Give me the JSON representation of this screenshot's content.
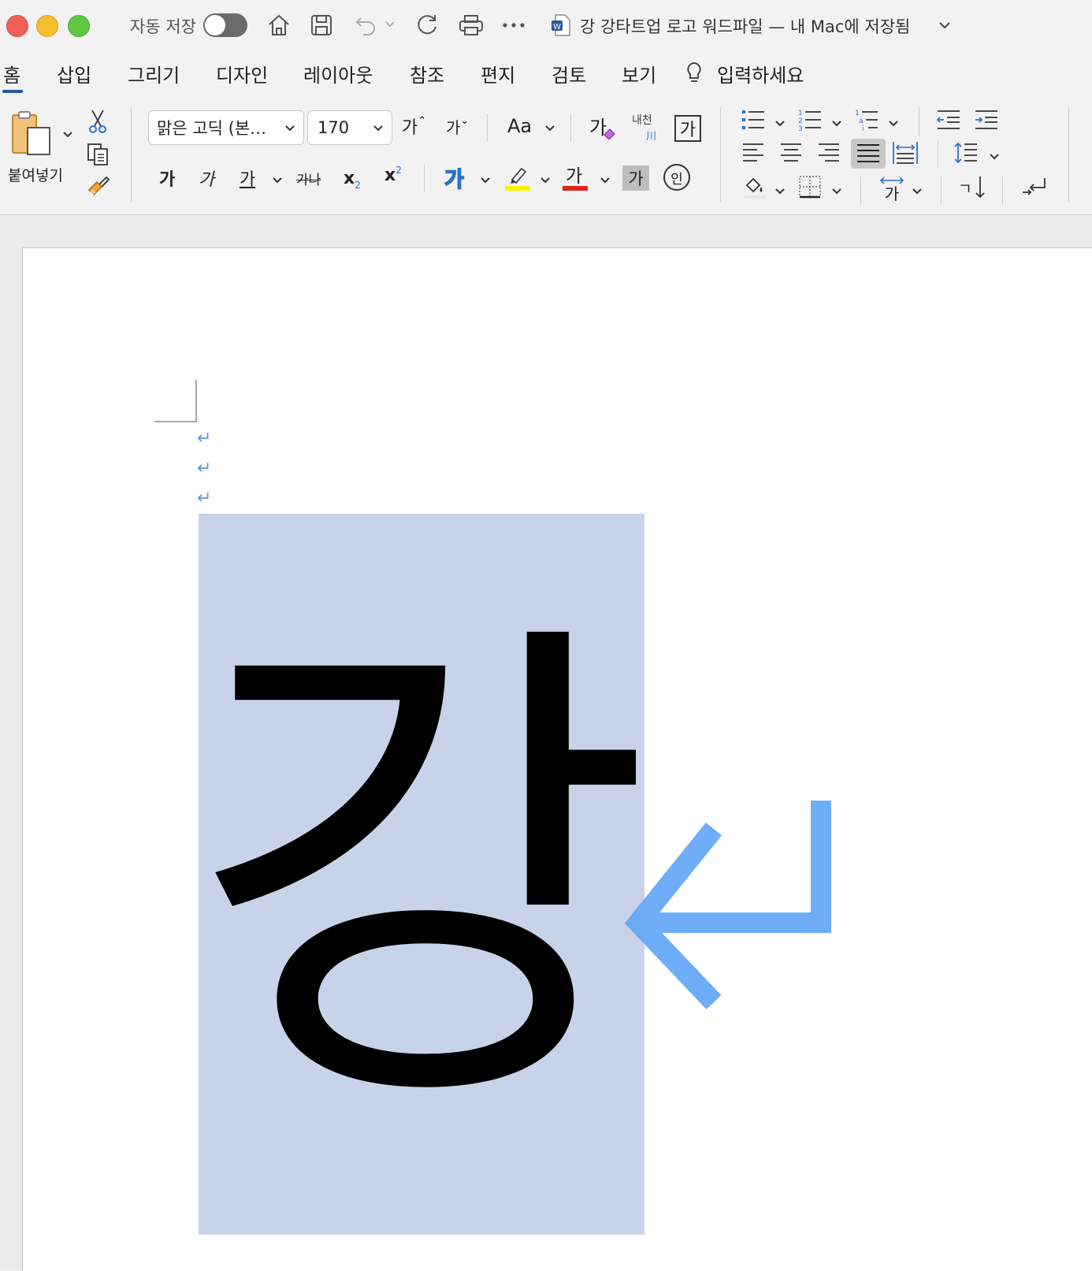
{
  "window": {
    "autosave_label": "자동 저장",
    "title": "강 강타트업 로고 워드파일 — 내 Mac에 저장됨"
  },
  "tabs": [
    {
      "label": "홈",
      "active": true
    },
    {
      "label": "삽입"
    },
    {
      "label": "그리기"
    },
    {
      "label": "디자인"
    },
    {
      "label": "레이아웃"
    },
    {
      "label": "참조"
    },
    {
      "label": "편지"
    },
    {
      "label": "검토"
    },
    {
      "label": "보기"
    }
  ],
  "tell_me": "입력하세요",
  "clipboard": {
    "paste_label": "붙여넣기"
  },
  "font": {
    "name": "맑은 고딕 (본…",
    "size": "170",
    "grow": "가",
    "shrink": "가",
    "change_case": "Aa",
    "clear_format": "가",
    "phonetic_top": "내천",
    "phonetic_bottom": "川",
    "char_border": "가",
    "bold": "가",
    "italic": "가",
    "underline": "가",
    "strike": "가나",
    "subscript": "x",
    "subscript_mark": "2",
    "superscript": "x",
    "superscript_mark": "2",
    "text_effect": "가",
    "font_color": "가",
    "char_shading": "가",
    "enclose": "인"
  },
  "paragraph": {
    "asian_layout": "가",
    "sort": "ㄱ"
  },
  "document": {
    "character": "강"
  },
  "colors": {
    "accent_blue": "#2b579a",
    "selection": "#c8d3ea",
    "para_mark": "#5b9bd5",
    "big_arrow": "#66a9f7",
    "highlight_yellow": "#f7f300",
    "font_red": "#e2231a"
  }
}
